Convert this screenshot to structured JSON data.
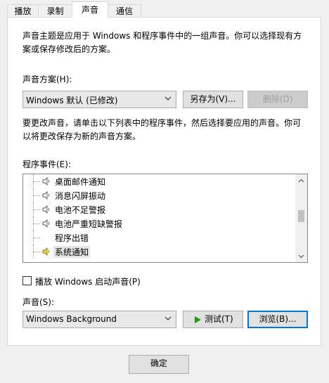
{
  "tabs": [
    "播放",
    "录制",
    "声音",
    "通信"
  ],
  "intro_text": "声音主题是应用于 Windows 和程序事件中的一组声音。你可以选择现有方案或保存修改后的方案。",
  "scheme_label": "声音方案(H):",
  "scheme_value": "Windows 默认 (已修改)",
  "save_as_label": "另存为(V)...",
  "delete_label": "删除(D)",
  "change_text": "要更改声音，请单击以下列表中的程序事件，然后选择要应用的声音。你可以将更改保存为新的声音方案。",
  "events_label": "程序事件(E):",
  "events": [
    {
      "label": "桌面邮件通知",
      "has_sound": true,
      "selected": false
    },
    {
      "label": "消息闪屏振动",
      "has_sound": true,
      "selected": false
    },
    {
      "label": "电池不足警报",
      "has_sound": true,
      "selected": false
    },
    {
      "label": "电池严重短缺警报",
      "has_sound": true,
      "selected": false
    },
    {
      "label": "程序出错",
      "has_sound": false,
      "selected": false
    },
    {
      "label": "系统通知",
      "has_sound": true,
      "selected": true
    }
  ],
  "play_startup_label": "播放 Windows 启动声音(P)",
  "play_startup_checked": false,
  "sound_label": "声音(S):",
  "sound_value": "Windows Background",
  "test_label": "测试(T)",
  "browse_label": "浏览(B)...",
  "ok_label": "确定",
  "icons": {
    "speaker": "speaker-icon",
    "dropdown": "chevron-down-icon",
    "play": "play-icon"
  },
  "colors": {
    "accent": "#0078d7",
    "play_green": "#1a9b1a",
    "speaker_selected": "#e6c800"
  }
}
